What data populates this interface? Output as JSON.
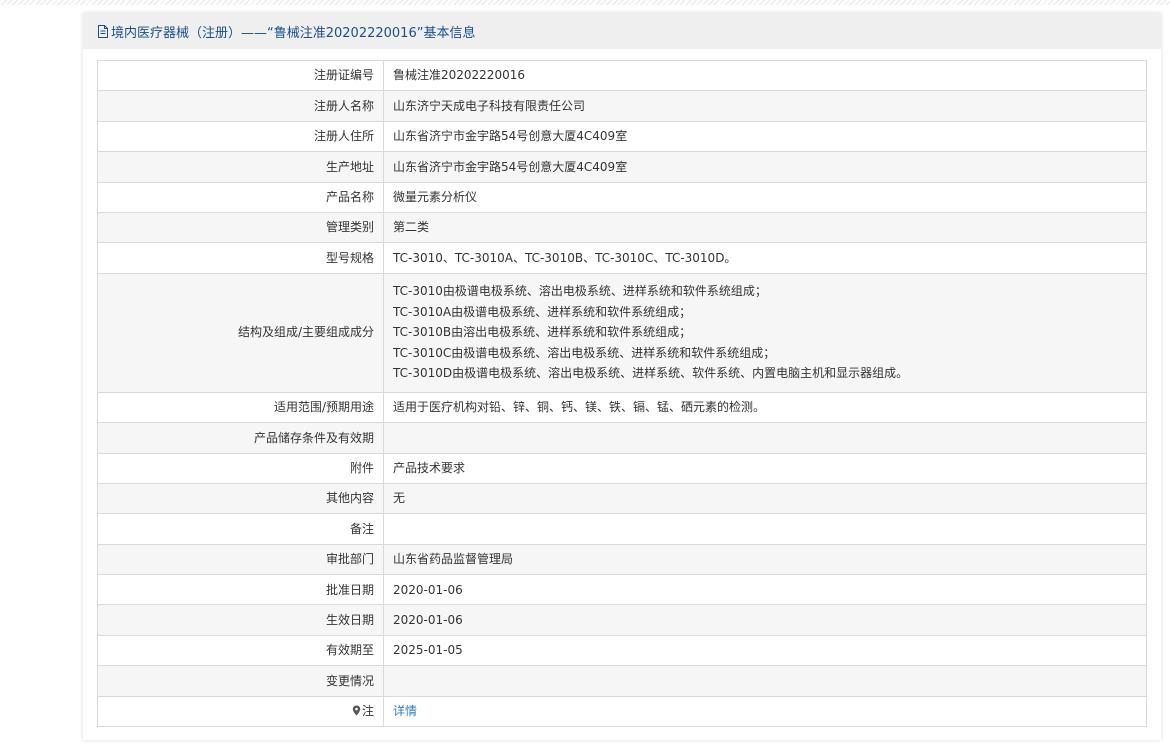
{
  "header": {
    "title": "境内医疗器械（注册）——“鲁械注准20202220016”基本信息"
  },
  "rows": [
    {
      "label": "注册证编号",
      "value": "鲁械注准20202220016"
    },
    {
      "label": "注册人名称",
      "value": "山东济宁天成电子科技有限责任公司"
    },
    {
      "label": "注册人住所",
      "value": "山东省济宁市金宇路54号创意大厦4C409室"
    },
    {
      "label": "生产地址",
      "value": "山东省济宁市金宇路54号创意大厦4C409室"
    },
    {
      "label": "产品名称",
      "value": "微量元素分析仪"
    },
    {
      "label": "管理类别",
      "value": "第二类"
    },
    {
      "label": "型号规格",
      "value": "TC-3010、TC-3010A、TC-3010B、TC-3010C、TC-3010D。"
    },
    {
      "label": "结构及组成/主要组成成分",
      "lines": [
        "TC-3010由极谱电极系统、溶出电极系统、进样系统和软件系统组成；",
        "TC-3010A由极谱电极系统、进样系统和软件系统组成；",
        "TC-3010B由溶出电极系统、进样系统和软件系统组成；",
        "TC-3010C由极谱电极系统、溶出电极系统、进样系统和软件系统组成；",
        "TC-3010D由极谱电极系统、溶出电极系统、进样系统、软件系统、内置电脑主机和显示器组成。"
      ]
    },
    {
      "label": "适用范围/预期用途",
      "value": "适用于医疗机构对铅、锌、铜、钙、镁、铁、镉、锰、硒元素的检测。"
    },
    {
      "label": "产品储存条件及有效期",
      "value": ""
    },
    {
      "label": "附件",
      "value": "产品技术要求"
    },
    {
      "label": "其他内容",
      "value": "无"
    },
    {
      "label": "备注",
      "value": ""
    },
    {
      "label": "审批部门",
      "value": "山东省药品监督管理局"
    },
    {
      "label": "批准日期",
      "value": "2020-01-06"
    },
    {
      "label": "生效日期",
      "value": "2020-01-06"
    },
    {
      "label": "有效期至",
      "value": "2025-01-05"
    },
    {
      "label": "变更情况",
      "value": ""
    },
    {
      "label": "注",
      "value": "详情"
    }
  ],
  "colors": {
    "header_text": "#1a4f8b",
    "link": "#2f7bc4",
    "border": "#d9d9d9",
    "stripe": "#f6f6f6"
  }
}
